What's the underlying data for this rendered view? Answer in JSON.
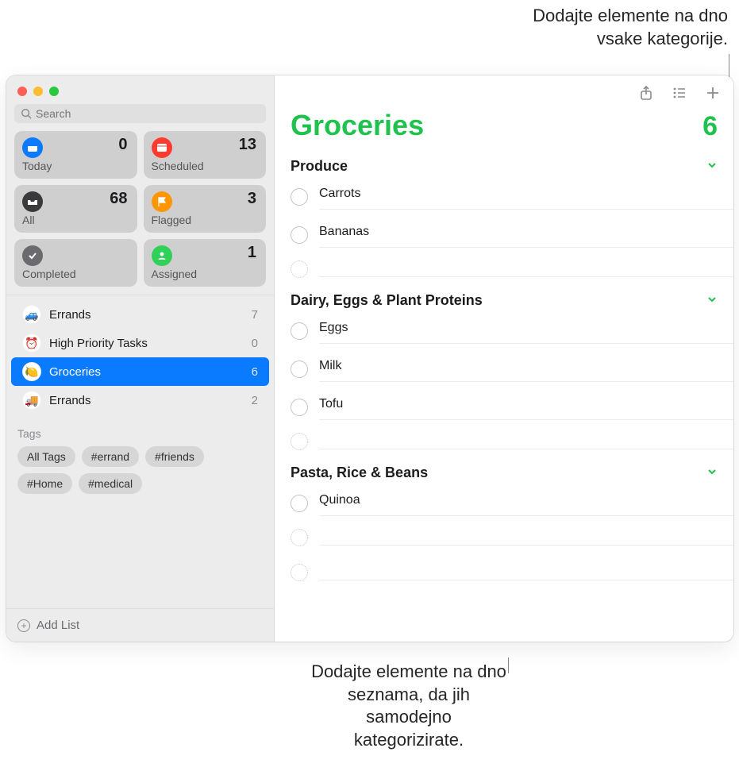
{
  "annotations": {
    "top": "Dodajte elemente na dno vsake kategorije.",
    "bottom": "Dodajte elemente na dno seznama, da jih samodejno kategorizirate."
  },
  "sidebar": {
    "search_placeholder": "Search",
    "smart": {
      "today": {
        "label": "Today",
        "count": "0"
      },
      "scheduled": {
        "label": "Scheduled",
        "count": "13"
      },
      "all": {
        "label": "All",
        "count": "68"
      },
      "flagged": {
        "label": "Flagged",
        "count": "3"
      },
      "completed": {
        "label": "Completed",
        "count": ""
      },
      "assigned": {
        "label": "Assigned",
        "count": "1"
      }
    },
    "lists": [
      {
        "name": "Errands",
        "count": "7",
        "emoji": "🚙"
      },
      {
        "name": "High Priority Tasks",
        "count": "0",
        "emoji": "⏰"
      },
      {
        "name": "Groceries",
        "count": "6",
        "emoji": "🍋"
      },
      {
        "name": "Errands",
        "count": "2",
        "emoji": "🚚"
      }
    ],
    "tags_title": "Tags",
    "tags": [
      "All Tags",
      "#errand",
      "#friends",
      "#Home",
      "#medical"
    ],
    "add_list": "Add List"
  },
  "main": {
    "title": "Groceries",
    "count": "6",
    "sections": [
      {
        "title": "Produce",
        "items": [
          "Carrots",
          "Bananas"
        ]
      },
      {
        "title": "Dairy, Eggs & Plant Proteins",
        "items": [
          "Eggs",
          "Milk",
          "Tofu"
        ]
      },
      {
        "title": "Pasta, Rice & Beans",
        "items": [
          "Quinoa"
        ]
      }
    ]
  }
}
